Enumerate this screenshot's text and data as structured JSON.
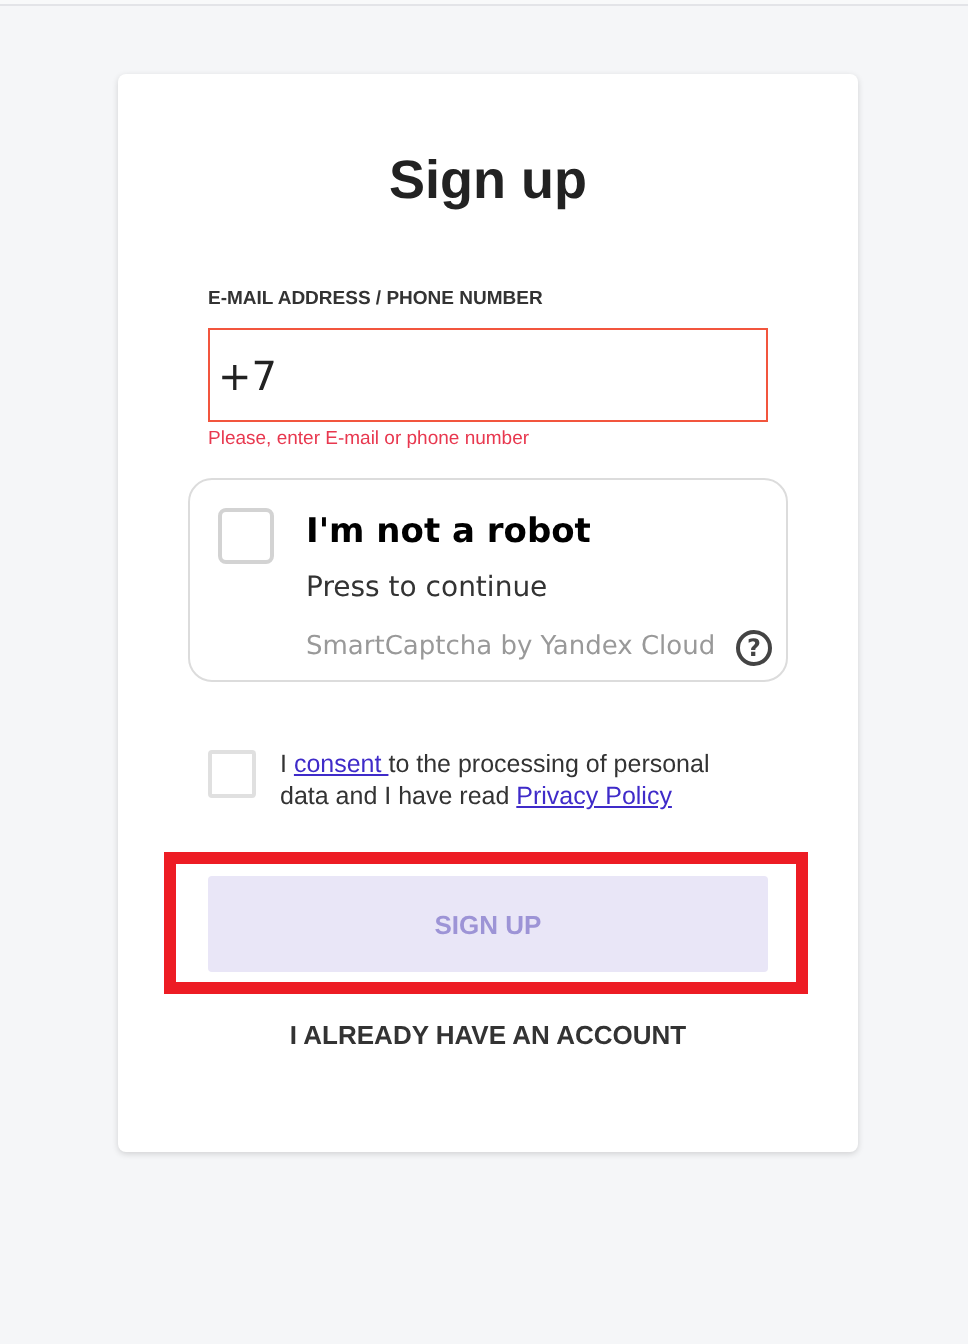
{
  "title": "Sign up",
  "contact_field": {
    "label": "E-MAIL ADDRESS / PHONE NUMBER",
    "value": "+7",
    "invalid": true,
    "error": "Please, enter E-mail or phone number"
  },
  "captcha": {
    "checked": false,
    "title": "I'm not a robot",
    "subtitle": "Press to continue",
    "provider": "SmartCaptcha by Yandex Cloud",
    "help": "?"
  },
  "consent": {
    "checked": false,
    "parts": [
      {
        "kind": "text",
        "text": "I "
      },
      {
        "kind": "link",
        "text": "consent "
      },
      {
        "kind": "text",
        "text": "to the processing of personal data and I have read "
      },
      {
        "kind": "link",
        "text": "Privacy Policy"
      }
    ]
  },
  "submit": {
    "label": "SIGN UP",
    "disabled": true,
    "highlighted": true
  },
  "login_link": {
    "label": "I ALREADY HAVE AN ACCOUNT"
  }
}
